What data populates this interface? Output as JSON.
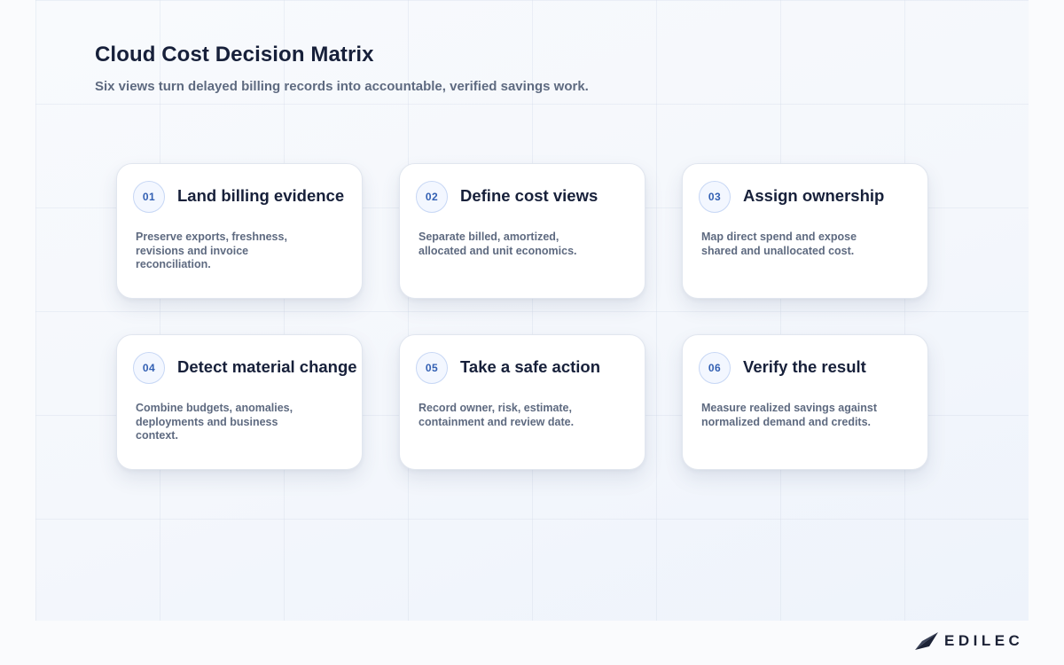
{
  "header": {
    "title": "Cloud Cost Decision Matrix",
    "subtitle": "Six views turn delayed billing records into accountable, verified savings work."
  },
  "steps": [
    {
      "number": "01",
      "title": "Land billing evidence",
      "description": "Preserve exports, freshness, revisions and invoice reconciliation."
    },
    {
      "number": "02",
      "title": "Define cost views",
      "description": "Separate billed, amortized, allocated and unit economics."
    },
    {
      "number": "03",
      "title": "Assign ownership",
      "description": "Map direct spend and expose shared and unallocated cost."
    },
    {
      "number": "04",
      "title": "Detect material change",
      "description": "Combine budgets, anomalies, deployments and business context."
    },
    {
      "number": "05",
      "title": "Take a safe action",
      "description": "Record owner, risk, estimate, containment and review date."
    },
    {
      "number": "06",
      "title": "Verify the result",
      "description": "Measure realized savings against normalized demand and credits."
    }
  ],
  "brand": {
    "name": "EDILEC",
    "icon": "paper-plane-logo-icon"
  },
  "colors": {
    "accent": "#3360b3",
    "title_text": "#17203a",
    "body_text": "#5e6a80"
  }
}
